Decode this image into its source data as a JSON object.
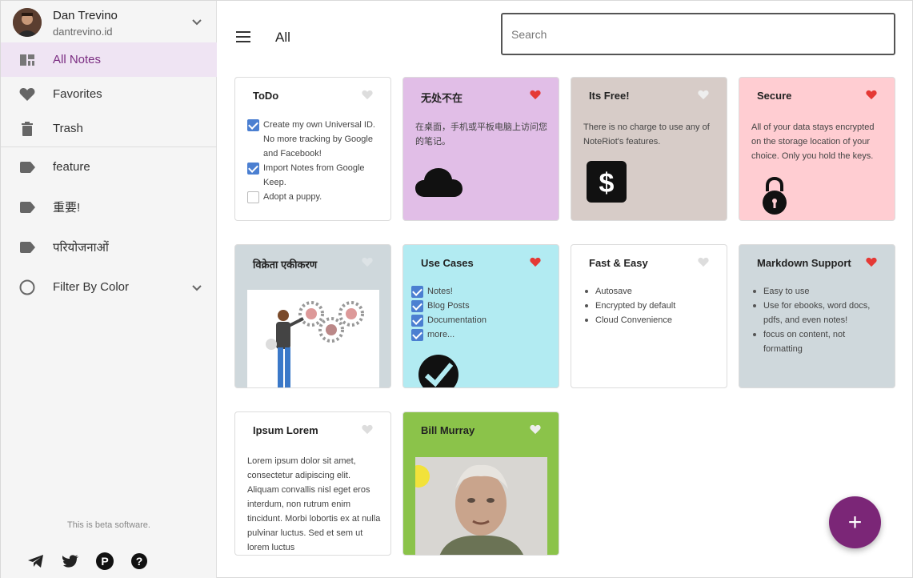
{
  "user": {
    "name": "Dan Trevino",
    "handle": "dantrevino.id"
  },
  "nav": {
    "all_notes": "All Notes",
    "favorites": "Favorites",
    "trash": "Trash",
    "tags": [
      "feature",
      "重要!",
      "परियोजनाओं"
    ],
    "filter_by_color": "Filter By Color"
  },
  "footer": {
    "beta": "This is beta software."
  },
  "header": {
    "title": "All",
    "search_placeholder": "Search"
  },
  "fab_label": "+",
  "colors": {
    "accent": "#7b2677",
    "active_nav_bg": "#efe4f3",
    "heart_on": "#e53935",
    "heart_off": "#dddddd",
    "card_white": "#ffffff",
    "card_purple": "#e1bee7",
    "card_taupe": "#d7ccc8",
    "card_pink": "#ffcdd2",
    "card_gray": "#cfd8dc",
    "card_cyan": "#b2ebf2",
    "card_green": "#8bc34a"
  },
  "notes": [
    {
      "title": "ToDo",
      "favorite": false,
      "color": "white",
      "checklist": [
        {
          "text": "Create my own Universal ID. No more tracking by Google and Facebook!",
          "checked": true
        },
        {
          "text": "Import Notes from Google Keep.",
          "checked": true
        },
        {
          "text": "Adopt a puppy.",
          "checked": false
        }
      ]
    },
    {
      "title": "无处不在",
      "favorite": true,
      "color": "purple",
      "text": "在桌面，手机或平板电脑上访问您的笔记。",
      "image": "cloud-icon"
    },
    {
      "title": "Its Free!",
      "favorite": false,
      "color": "taupe",
      "text": "There is no charge to use any of NoteRiot's features.",
      "image": "dollar-icon"
    },
    {
      "title": "Secure",
      "favorite": true,
      "color": "pink",
      "text": "All of your data stays encrypted on the storage location of your choice. Only you hold the keys.",
      "image": "padlock-icon"
    },
    {
      "title": "विक्रेता एकीकरण",
      "favorite": false,
      "color": "gray",
      "image": "integration-illustration"
    },
    {
      "title": "Use Cases",
      "favorite": true,
      "color": "cyan",
      "checklist": [
        {
          "text": "Notes!",
          "checked": true
        },
        {
          "text": "Blog Posts",
          "checked": true
        },
        {
          "text": "Documentation",
          "checked": true
        },
        {
          "text": "more...",
          "checked": true
        }
      ],
      "image": "check-circle-icon"
    },
    {
      "title": "Fast & Easy",
      "favorite": false,
      "color": "white",
      "bullets": [
        "Autosave",
        "Encrypted by default",
        "Cloud Convenience"
      ]
    },
    {
      "title": "Markdown Support",
      "favorite": true,
      "color": "gray",
      "bullets": [
        "Easy to use",
        "Use for ebooks, word docs, pdfs, and even notes!",
        "focus on content, not formatting"
      ]
    },
    {
      "title": "Ipsum Lorem",
      "favorite": false,
      "color": "white",
      "text": "Lorem ipsum dolor sit amet, consectetur adipiscing elit. Aliquam convallis nisl eget eros interdum, non rutrum enim tincidunt. Morbi lobortis ex at nulla pulvinar luctus. Sed et sem ut lorem luctus"
    },
    {
      "title": "Bill Murray",
      "favorite": true,
      "color": "green",
      "image": "portrait-photo"
    }
  ]
}
